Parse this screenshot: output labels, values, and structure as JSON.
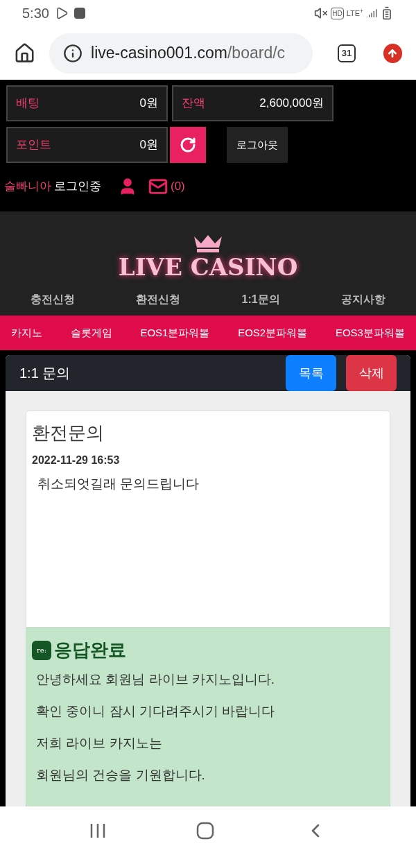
{
  "status_bar": {
    "time": "5:30",
    "hd": "HD",
    "network": "LTE$^{+}$"
  },
  "browser": {
    "url_host": "live-casino001.com",
    "url_path": "/board/c",
    "tab_count": "31"
  },
  "account": {
    "stats": [
      {
        "label": "배팅",
        "value": "0원"
      },
      {
        "label": "잔액",
        "value": "2,600,000원"
      },
      {
        "label": "포인트",
        "value": "0원"
      }
    ],
    "logout": "로그아웃",
    "username": "술빠니아",
    "login_status": "로그인중",
    "message_count": "(0)"
  },
  "logo": {
    "text": "LIVE CASINO"
  },
  "menu": [
    {
      "label": "충전신청"
    },
    {
      "label": "환전신청"
    },
    {
      "label": "1:1문의"
    },
    {
      "label": "공지사항"
    }
  ],
  "games": [
    {
      "label": "카지노"
    },
    {
      "label": "슬롯게임"
    },
    {
      "label": "EOS1분파워볼"
    },
    {
      "label": "EOS2분파워볼"
    },
    {
      "label": "EOS3분파워볼"
    }
  ],
  "panel": {
    "title": "1:1 문의",
    "buttons": [
      {
        "label": "목록",
        "kind": "primary"
      },
      {
        "label": "삭제",
        "kind": "danger"
      }
    ]
  },
  "question": {
    "title": "환전문의",
    "date": "2022-11-29 16:53",
    "body": "취소되엇길래 문의드립니다"
  },
  "answer": {
    "badge": "re:",
    "title": "응답완료",
    "lines": [
      "안녕하세요 회원님 라이브 카지노입니다.",
      "확인 중이니 잠시 기다려주시기 바랍니다",
      "저희 라이브 카지노는",
      "회원님의 건승을 기원합니다."
    ]
  }
}
